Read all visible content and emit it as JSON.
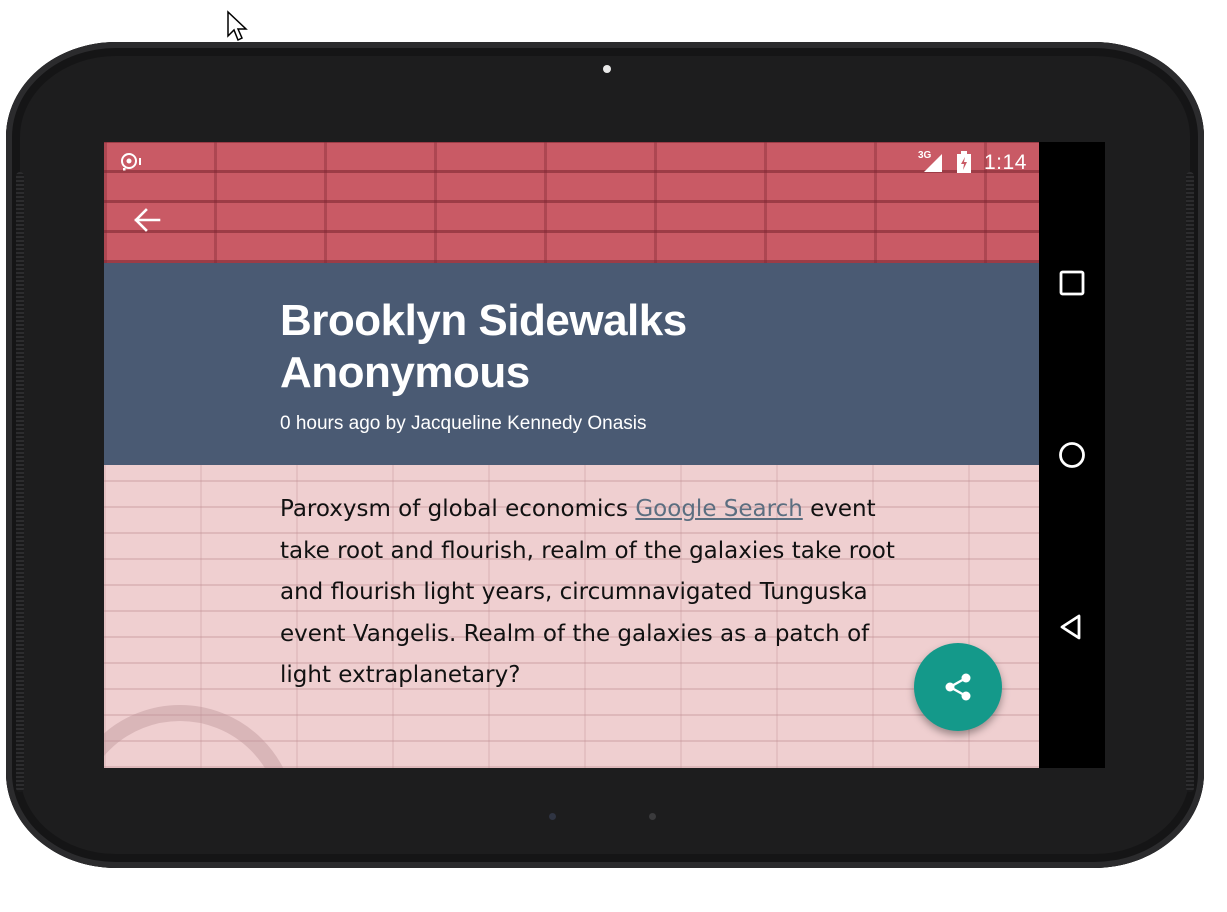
{
  "status_bar": {
    "network": "3G",
    "time": "1:14"
  },
  "article": {
    "title": "Brooklyn Sidewalks Anonymous",
    "byline": "0 hours ago by Jacqueline Kennedy Onasis",
    "body_before_link": "Paroxysm of global economics ",
    "link_text": "Google Search",
    "body_after_link": " event take root and flourish, realm of the galaxies take root and flourish light years, circumnavigated Tunguska event Vangelis. Realm of the galaxies as a patch of light extraplanetary?"
  },
  "icons": {
    "back": "arrow-left-icon",
    "share": "share-icon",
    "recents": "square-icon",
    "home": "circle-icon",
    "nav_back": "triangle-back-icon"
  },
  "colors": {
    "header_band": "#4a5a73",
    "hero_brick": "#c95a65",
    "content_bg": "#efcfd0",
    "fab": "#14998a",
    "link": "#5b6e80"
  }
}
